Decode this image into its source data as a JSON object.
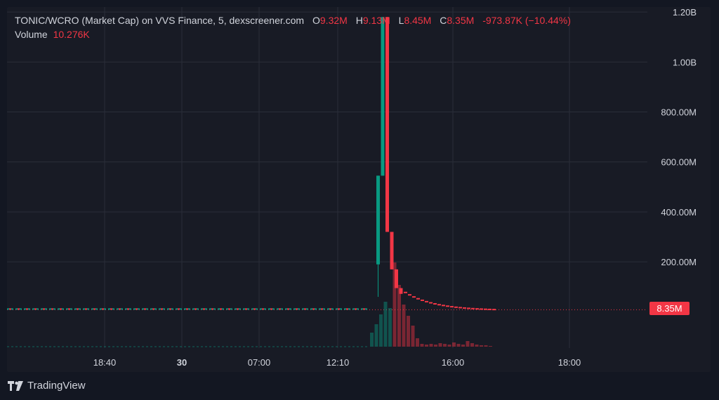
{
  "legend": {
    "title": "TONIC/WCRO (Market Cap) on VVS Finance, 5, dexscreener.com",
    "o_label": "O",
    "o_value": "9.32M",
    "h_label": "H",
    "h_value": "9.13M",
    "l_label": "L",
    "l_value": "8.45M",
    "c_label": "C",
    "c_value": "8.35M",
    "change": "-973.87K (−10.44%)",
    "volume_label": "Volume",
    "volume_value": "10.276K"
  },
  "price_tag": "8.35M",
  "brand": "TradingView",
  "colors": {
    "background": "#131722",
    "panel": "#181b25",
    "grid": "#2a2e39",
    "up": "#089981",
    "down": "#f23645",
    "text": "#d1d4dc"
  },
  "chart_data": {
    "type": "candlestick",
    "y_unit": "market cap (USD)",
    "ylim": [
      -145000000,
      1220000000
    ],
    "y_ticks": [
      {
        "value": 200000000,
        "label": "200.00M"
      },
      {
        "value": 400000000,
        "label": "400.00M"
      },
      {
        "value": 600000000,
        "label": "600.00M"
      },
      {
        "value": 800000000,
        "label": "800.00M"
      },
      {
        "value": 1000000000,
        "label": "1.00B"
      },
      {
        "value": 1200000000,
        "label": "1.20B"
      }
    ],
    "x_ticks": [
      "18:40",
      "30",
      "07:00",
      "12:10",
      "16:00",
      "18:00"
    ],
    "last_price": 8350000,
    "grid": true,
    "candles": [
      {
        "o": 190000000,
        "h": 545000000,
        "l": 60000000,
        "c": 545000000
      },
      {
        "o": 545000000,
        "h": 1180000000,
        "l": 545000000,
        "c": 1180000000
      },
      {
        "o": 1180000000,
        "h": 1180000000,
        "l": 320000000,
        "c": 320000000
      },
      {
        "o": 320000000,
        "h": 320000000,
        "l": 170000000,
        "c": 170000000
      },
      {
        "o": 170000000,
        "h": 170000000,
        "l": 95000000,
        "c": 95000000
      },
      {
        "o": 95000000,
        "h": 95000000,
        "l": 72000000,
        "c": 72000000
      }
    ],
    "volume_note": "volume bars shown as histogram below price, peak near the spike"
  }
}
